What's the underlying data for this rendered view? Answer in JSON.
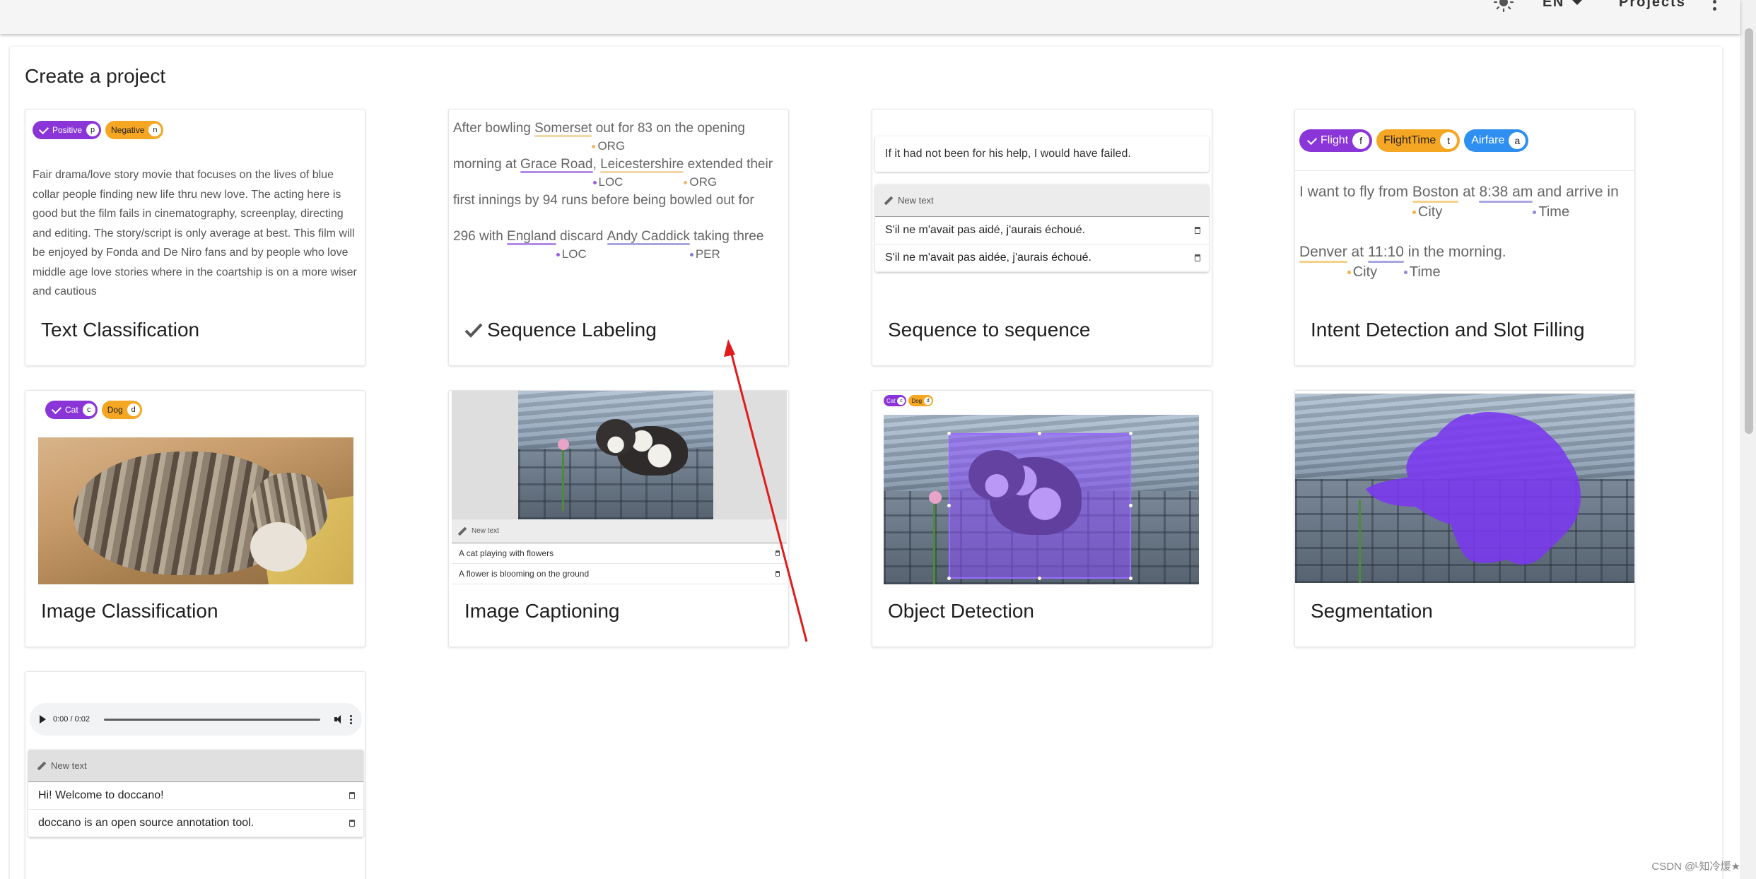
{
  "topbar": {
    "theme_icon": "sun-icon",
    "language": "EN",
    "projects_label": "Projects",
    "menu_icon": "kebab-menu-icon"
  },
  "page": {
    "title": "Create a project"
  },
  "text_classification": {
    "title": "Text Classification",
    "labels": [
      {
        "name": "Positive",
        "key": "p",
        "color": "#8a35d8",
        "selected": true
      },
      {
        "name": "Negative",
        "key": "n",
        "color": "#f5a623",
        "selected": false
      }
    ],
    "text": "Fair drama/love story movie that focuses on the lives of blue collar people finding new life thru new love. The acting here is good but the film fails in cinematography, screenplay, directing and editing. The story/script is only average at best. This film will be enjoyed by Fonda and De Niro fans and by people who love middle age love stories where in the coartship is on a more wiser and cautious"
  },
  "sequence_labeling": {
    "title": "Sequence Labeling",
    "selected": true,
    "line1": {
      "pre": "After bowling ",
      "ent": "Somerset",
      "tag": "ORG",
      "post": " out for 83 on the opening"
    },
    "line2": {
      "pre": "morning at ",
      "ent1": "Grace Road",
      "tag1": "LOC",
      "mid": ", ",
      "ent2": "Leicestershire",
      "tag2": "ORG",
      "post": " extended their"
    },
    "line3": {
      "text": "first innings by 94 runs before being bowled out for"
    },
    "line4": {
      "pre": "296 with ",
      "ent1": "England",
      "tag1": "LOC",
      "mid": " discard ",
      "ent2": "Andy Caddick",
      "tag2": "PER",
      "post": " taking three"
    }
  },
  "seq2seq": {
    "title": "Sequence to sequence",
    "source": "If it had not been for his help, I would have failed.",
    "new_text_label": "New text",
    "targets": [
      "S'il ne m'avait pas aidé, j'aurais échoué.",
      "S'il ne m'avait pas aidée, j'aurais échoué."
    ]
  },
  "intent_detection": {
    "title": "Intent Detection and Slot Filling",
    "labels": [
      {
        "name": "Flight",
        "key": "f",
        "color": "#8a35d8",
        "selected": true
      },
      {
        "name": "FlightTime",
        "key": "t",
        "color": "#f5a623",
        "selected": false
      },
      {
        "name": "Airfare",
        "key": "a",
        "color": "#2e8ff0",
        "selected": false
      }
    ],
    "line1": {
      "pre": "I want to fly from ",
      "ent1": "Boston",
      "tag1": "City",
      "mid": " at ",
      "ent2": "8:38 am",
      "tag2": "Time",
      "post": " and arrive in"
    },
    "line2": {
      "ent1": "Denver",
      "tag1": "City",
      "mid": " at ",
      "ent2": "11:10",
      "tag2": "Time",
      "post": " in the morning."
    }
  },
  "image_classification": {
    "title": "Image Classification",
    "labels": [
      {
        "name": "Cat",
        "key": "c",
        "color": "#8a35d8",
        "selected": true
      },
      {
        "name": "Dog",
        "key": "d",
        "color": "#f5a623",
        "selected": false
      }
    ]
  },
  "image_captioning": {
    "title": "Image Captioning",
    "new_text_label": "New text",
    "captions": [
      "A cat playing with flowers",
      "A flower is blooming on the ground"
    ]
  },
  "object_detection": {
    "title": "Object Detection",
    "labels": [
      {
        "name": "Cat",
        "key": "c",
        "selected": true
      },
      {
        "name": "Dog",
        "key": "d",
        "selected": false
      }
    ]
  },
  "segmentation": {
    "title": "Segmentation"
  },
  "speech_to_text": {
    "time": "0:00 / 0:02",
    "new_text_label": "New text",
    "texts": [
      "Hi! Welcome to doccano!",
      "doccano is an open source annotation tool."
    ]
  },
  "colors": {
    "accent_purple": "#8a35d8",
    "accent_orange": "#f5a623",
    "accent_blue": "#2e8ff0",
    "annotation_arrow": "#e11b1b"
  },
  "watermark": "CSDN @ᴸ知冷煖★"
}
